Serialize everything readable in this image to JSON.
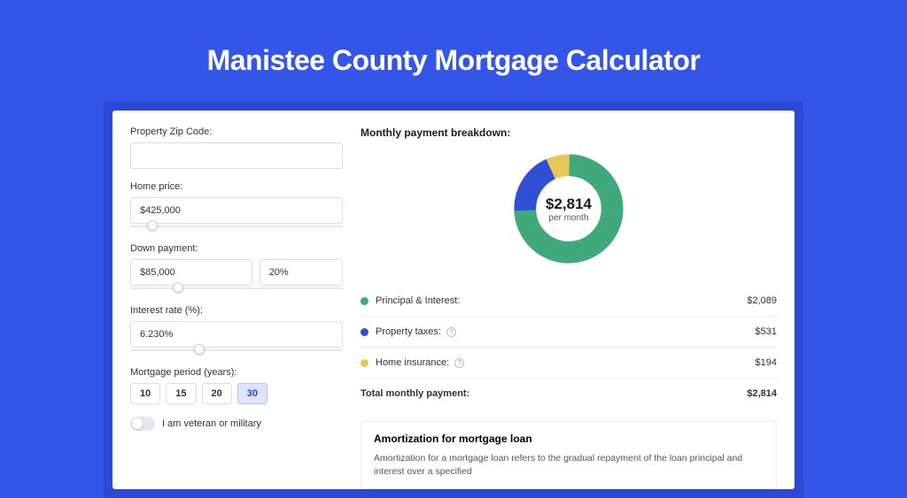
{
  "hero": {
    "title": "Manistee County Mortgage Calculator"
  },
  "form": {
    "zip_label": "Property Zip Code:",
    "zip_value": "",
    "home_price_label": "Home price:",
    "home_price_value": "$425,000",
    "down_payment_label": "Down payment:",
    "down_payment_value": "$85,000",
    "down_payment_pct": "20%",
    "interest_label": "Interest rate (%):",
    "interest_value": "6.230%",
    "period_label": "Mortgage period (years):",
    "periods": [
      "10",
      "15",
      "20",
      "30"
    ],
    "period_active": "30",
    "veteran_label": "I am veteran or military"
  },
  "breakdown": {
    "title": "Monthly payment breakdown:",
    "center_amount": "$2,814",
    "center_sub": "per month",
    "items": [
      {
        "label": "Principal & Interest:",
        "value": "$2,089",
        "color": "#40a97b",
        "info": false
      },
      {
        "label": "Property taxes:",
        "value": "$531",
        "color": "#2f4fd6",
        "info": true
      },
      {
        "label": "Home insurance:",
        "value": "$194",
        "color": "#e9c756",
        "info": true
      }
    ],
    "total_label": "Total monthly payment:",
    "total_value": "$2,814"
  },
  "chart_data": {
    "type": "pie",
    "title": "Monthly payment breakdown",
    "series": [
      {
        "name": "Principal & Interest",
        "value": 2089,
        "color": "#40a97b"
      },
      {
        "name": "Property taxes",
        "value": 531,
        "color": "#2f4fd6"
      },
      {
        "name": "Home insurance",
        "value": 194,
        "color": "#e9c756"
      }
    ],
    "total": 2814,
    "unit": "USD/month"
  },
  "amortization": {
    "title": "Amortization for mortgage loan",
    "body": "Amortization for a mortgage loan refers to the gradual repayment of the loan principal and interest over a specified"
  }
}
